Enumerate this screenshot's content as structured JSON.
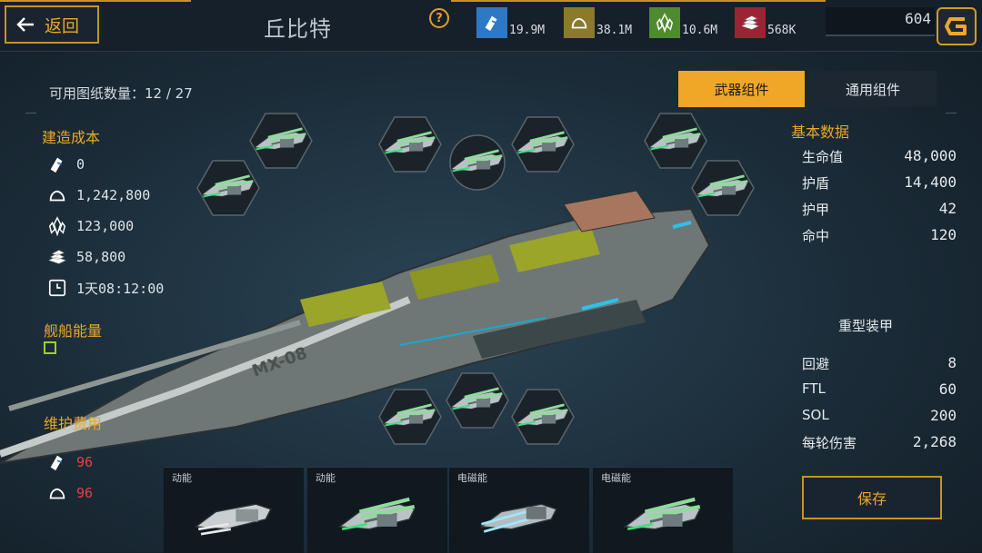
{
  "header": {
    "back_label": "返回",
    "ship_name": "丘比特",
    "resources": [
      {
        "icon": "metal-icon",
        "value": "19.9M",
        "color": "#2e78c5"
      },
      {
        "icon": "gas-icon",
        "value": "38.1M",
        "color": "#8a7a2a"
      },
      {
        "icon": "crystal-icon",
        "value": "10.6M",
        "color": "#4e8a2e"
      },
      {
        "icon": "ingot-icon",
        "value": "568K",
        "color": "#9b2434"
      }
    ],
    "credits": "604"
  },
  "left": {
    "blueprint_label": "可用图纸数量：12 / 27",
    "build_cost_title": "建造成本",
    "build_cost": [
      {
        "icon": "metal-icon",
        "value": "0"
      },
      {
        "icon": "gas-icon",
        "value": "1,242,800"
      },
      {
        "icon": "crystal-icon",
        "value": "123,000"
      },
      {
        "icon": "ingot-icon",
        "value": "58,800"
      },
      {
        "icon": "clock-icon",
        "value": "1天08:12:00"
      }
    ],
    "energy_title": "舰船能量",
    "maintenance_title": "维护费用",
    "maintenance": [
      {
        "icon": "metal-icon",
        "value": "96"
      },
      {
        "icon": "gas-icon",
        "value": "96"
      }
    ]
  },
  "tabs": {
    "weapon": "武器组件",
    "general": "通用组件"
  },
  "right": {
    "basic_title": "基本数据",
    "basic": [
      {
        "label": "生命值",
        "value": "48,000"
      },
      {
        "label": "护盾",
        "value": "14,400"
      },
      {
        "label": "护甲",
        "value": "42"
      },
      {
        "label": "命中",
        "value": "120"
      }
    ],
    "armor_type": "重型装甲",
    "extra": [
      {
        "label": "回避",
        "value": "8"
      },
      {
        "label": "FTL",
        "value": "60"
      },
      {
        "label": "SOL",
        "value": "200"
      },
      {
        "label": "每轮伤害",
        "value": "2,268"
      }
    ],
    "save_label": "保存"
  },
  "ship": {
    "hull_marking": "MX-08"
  },
  "components": [
    {
      "label": "动能"
    },
    {
      "label": "动能"
    },
    {
      "label": "电磁能"
    },
    {
      "label": "电磁能"
    }
  ],
  "colors": {
    "accent": "#f0a727",
    "energy": "#9ccf2d",
    "cost_red": "#e24545"
  }
}
